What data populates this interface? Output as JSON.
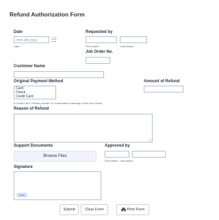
{
  "form": {
    "title": "Refund Authorization Form"
  },
  "date": {
    "label": "Date",
    "placeholder": "mm-dd-yyyy",
    "sublabel": "Date"
  },
  "requested_by": {
    "label": "Requested by",
    "first_name_sublabel": "First Name",
    "last_name_sublabel": "Last Name"
  },
  "job_order": {
    "label": "Job Order No."
  },
  "customer_name": {
    "label": "Customer Name"
  },
  "payment_method": {
    "label": "Original Payment Method",
    "options": [
      "Cash",
      "Check",
      "Credit Card"
    ],
    "note": "If Credit Card, Please provide CC information manually on the box below."
  },
  "amount_of_refund": {
    "label": "Amount of Refund"
  },
  "reason": {
    "label": "Reason of Refund"
  },
  "support_documents": {
    "label": "Support Documents",
    "browse_label": "Browse Files"
  },
  "approved_by": {
    "label": "Approved by",
    "first_name_sublabel": "First Name",
    "last_name_sublabel": "Last Name"
  },
  "signature": {
    "label": "Signature",
    "clear_label": "Clear"
  },
  "actions": {
    "submit_label": "Submit",
    "clear_form_label": "Clear Form",
    "print_form_label": "Print Form"
  },
  "icons": {
    "calendar": "calendar-icon",
    "print": "printer-icon"
  }
}
